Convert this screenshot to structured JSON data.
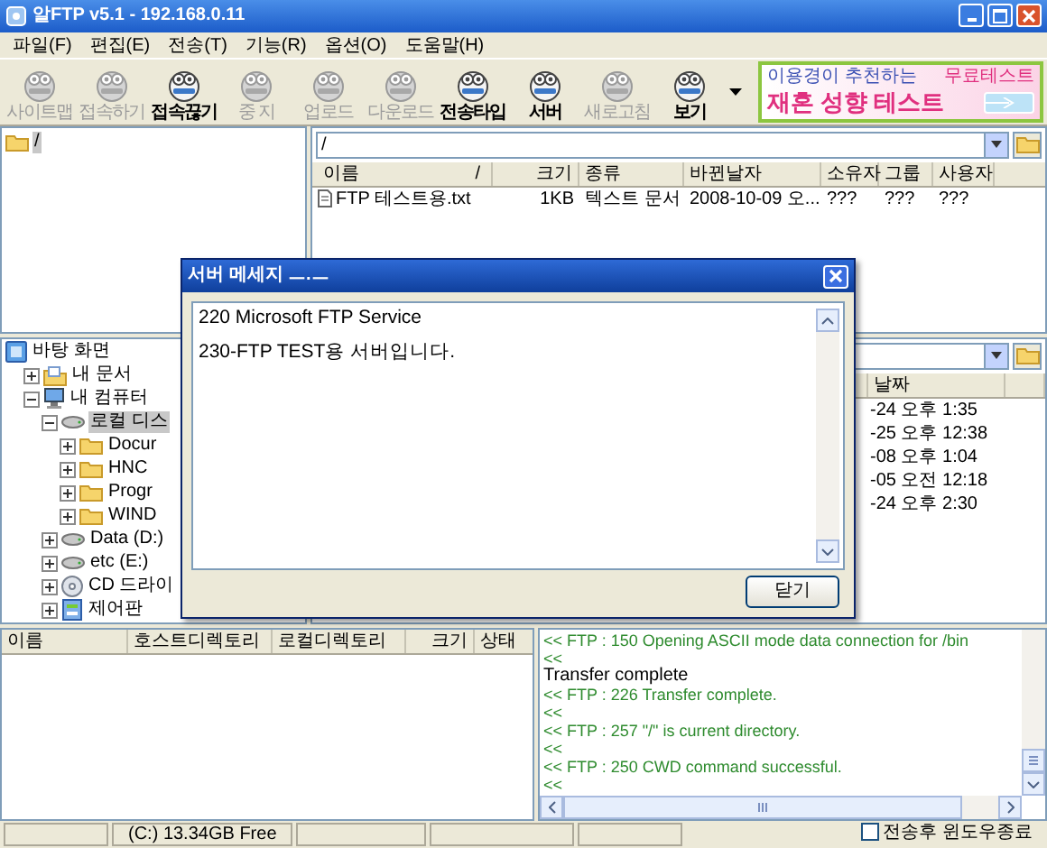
{
  "window": {
    "title": "알FTP v5.1 - 192.168.0.11"
  },
  "menu": [
    "파일(F)",
    "편집(E)",
    "전송(T)",
    "기능(R)",
    "옵션(O)",
    "도움말(H)"
  ],
  "toolbar": [
    {
      "label": "사이트맵",
      "disabled": true
    },
    {
      "label": "접속하기",
      "disabled": true
    },
    {
      "label": "접속끊기",
      "disabled": false
    },
    {
      "label": "중 지",
      "disabled": true
    },
    {
      "label": "업로드",
      "disabled": true
    },
    {
      "label": "다운로드",
      "disabled": true
    },
    {
      "label": "전송타입",
      "disabled": false
    },
    {
      "label": "서버",
      "disabled": false
    },
    {
      "label": "새로고침",
      "disabled": true
    },
    {
      "label": "보기",
      "disabled": false
    }
  ],
  "ad_banner": {
    "tagline": "이용경이 추천하는",
    "badge": "무료테스트",
    "headline": "재혼 성향 테스트"
  },
  "remote": {
    "tree": [
      {
        "label": "/",
        "kind": "folder",
        "selected": true
      }
    ],
    "path": "/",
    "columns": [
      "이름",
      "크기",
      "종류",
      "바뀐날자",
      "소유자",
      "그룹",
      "사용자"
    ],
    "sort_mark": "/",
    "files": [
      {
        "name": "FTP 테스트용.txt",
        "size": "1KB",
        "type": "텍스트 문서",
        "modified": "2008-10-09 오...",
        "owner": "???",
        "group": "???",
        "user": "???",
        "selected": false
      }
    ]
  },
  "local": {
    "tree": [
      {
        "label": "바탕 화면",
        "kind": "desktop",
        "selected": false,
        "children": [
          {
            "label": "내 문서",
            "kind": "documents",
            "expanded": false,
            "selected": false
          },
          {
            "label": "내 컴퓨터",
            "kind": "computer",
            "expanded": true,
            "selected": false,
            "children": [
              {
                "label": "로컬 디스",
                "kind": "drive",
                "expanded": true,
                "selected": true,
                "children": [
                  {
                    "label": "Docur",
                    "kind": "folder",
                    "expanded": false,
                    "selected": false
                  },
                  {
                    "label": "HNC",
                    "kind": "folder",
                    "expanded": false,
                    "selected": false
                  },
                  {
                    "label": "Progr",
                    "kind": "folder",
                    "expanded": false,
                    "selected": false
                  },
                  {
                    "label": "WIND",
                    "kind": "folder",
                    "expanded": false,
                    "selected": false
                  }
                ]
              },
              {
                "label": "Data (D:)",
                "kind": "drive",
                "expanded": false,
                "selected": false
              },
              {
                "label": "etc (E:)",
                "kind": "drive",
                "expanded": false,
                "selected": false
              },
              {
                "label": "CD 드라이",
                "kind": "cdrom",
                "expanded": false,
                "selected": false
              },
              {
                "label": "제어판",
                "kind": "control-panel",
                "expanded": false,
                "selected": false
              }
            ]
          }
        ]
      }
    ],
    "list_column": "날짜",
    "rows": [
      {
        "date": "-24 오후 1:35",
        "selected": false
      },
      {
        "date": "-25 오후 12:38",
        "selected": false
      },
      {
        "date": "-08 오후 1:04",
        "selected": false
      },
      {
        "date": "-05 오전 12:18",
        "selected": false
      },
      {
        "date": "-24 오후 2:30",
        "selected": false
      }
    ]
  },
  "dialog": {
    "title": "서버 메세지 ㅡ.ㅡ",
    "lines": [
      "220 Microsoft FTP Service",
      "230-FTP TEST용 서버입니다."
    ],
    "button": "닫기"
  },
  "queue": {
    "columns": [
      "이름",
      "호스트디렉토리",
      "로컬디렉토리",
      "크기",
      "상태"
    ]
  },
  "log": [
    {
      "kind": "server",
      "text": "<< FTP : 150 Opening ASCII mode data connection for /bin"
    },
    {
      "kind": "server",
      "text": "<<"
    },
    {
      "kind": "info",
      "text": "Transfer complete"
    },
    {
      "kind": "server",
      "text": "<< FTP : 226 Transfer complete."
    },
    {
      "kind": "server",
      "text": "<<"
    },
    {
      "kind": "server",
      "text": "<< FTP : 257 \"/\" is current directory."
    },
    {
      "kind": "server",
      "text": "<<"
    },
    {
      "kind": "server",
      "text": "<< FTP : 250 CWD command successful."
    },
    {
      "kind": "server",
      "text": "<<"
    }
  ],
  "status_bar": {
    "disk_free": "(C:) 13.34GB Free",
    "close_after_transfer": {
      "label": "전송후 윈도우종료",
      "checked": false
    }
  }
}
